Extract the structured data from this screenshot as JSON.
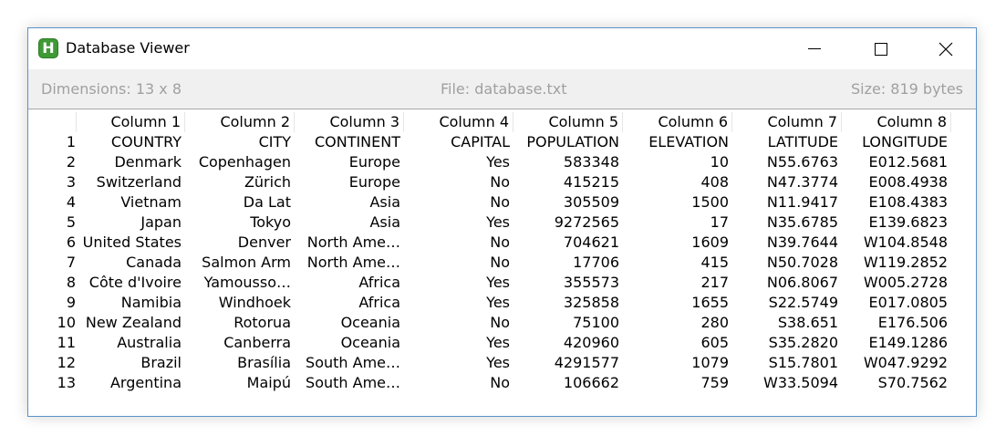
{
  "window": {
    "title": "Database Viewer",
    "icon_letter": "H",
    "icon_color": "#3f9a36",
    "border_color": "#5a91c8"
  },
  "infobar": {
    "dimensions": "Dimensions: 13 x 8",
    "file": "File: database.txt",
    "size": "Size: 819 bytes"
  },
  "table": {
    "columns": [
      "Column 1",
      "Column 2",
      "Column 3",
      "Column 4",
      "Column 5",
      "Column 6",
      "Column 7",
      "Column 8"
    ],
    "rows": [
      {
        "num": "1",
        "cells": [
          "COUNTRY",
          "CITY",
          "CONTINENT",
          "CAPITAL",
          "POPULATION",
          "ELEVATION",
          "LATITUDE",
          "LONGITUDE"
        ]
      },
      {
        "num": "2",
        "cells": [
          "Denmark",
          "Copenhagen",
          "Europe",
          "Yes",
          "583348",
          "10",
          "N55.6763",
          "E012.5681"
        ]
      },
      {
        "num": "3",
        "cells": [
          "Switzerland",
          "Zürich",
          "Europe",
          "No",
          "415215",
          "408",
          "N47.3774",
          "E008.4938"
        ]
      },
      {
        "num": "4",
        "cells": [
          "Vietnam",
          "Da Lat",
          "Asia",
          "No",
          "305509",
          "1500",
          "N11.9417",
          "E108.4383"
        ]
      },
      {
        "num": "5",
        "cells": [
          "Japan",
          "Tokyo",
          "Asia",
          "Yes",
          "9272565",
          "17",
          "N35.6785",
          "E139.6823"
        ]
      },
      {
        "num": "6",
        "cells": [
          "United States",
          "Denver",
          "North Ame…",
          "No",
          "704621",
          "1609",
          "N39.7644",
          "W104.8548"
        ]
      },
      {
        "num": "7",
        "cells": [
          "Canada",
          "Salmon Arm",
          "North Ame…",
          "No",
          "17706",
          "415",
          "N50.7028",
          "W119.2852"
        ]
      },
      {
        "num": "8",
        "cells": [
          "Côte d'Ivoire",
          "Yamousso…",
          "Africa",
          "Yes",
          "355573",
          "217",
          "N06.8067",
          "W005.2728"
        ]
      },
      {
        "num": "9",
        "cells": [
          "Namibia",
          "Windhoek",
          "Africa",
          "Yes",
          "325858",
          "1655",
          "S22.5749",
          "E017.0805"
        ]
      },
      {
        "num": "10",
        "cells": [
          "New Zealand",
          "Rotorua",
          "Oceania",
          "No",
          "75100",
          "280",
          "S38.651",
          "E176.506"
        ]
      },
      {
        "num": "11",
        "cells": [
          "Australia",
          "Canberra",
          "Oceania",
          "Yes",
          "420960",
          "605",
          "S35.2820",
          "E149.1286"
        ]
      },
      {
        "num": "12",
        "cells": [
          "Brazil",
          "Brasília",
          "South Ame…",
          "Yes",
          "4291577",
          "1079",
          "S15.7801",
          "W047.9292"
        ]
      },
      {
        "num": "13",
        "cells": [
          "Argentina",
          "Maipú",
          "South Ame…",
          "No",
          "106662",
          "759",
          "W33.5094",
          "S70.7562"
        ]
      }
    ]
  }
}
